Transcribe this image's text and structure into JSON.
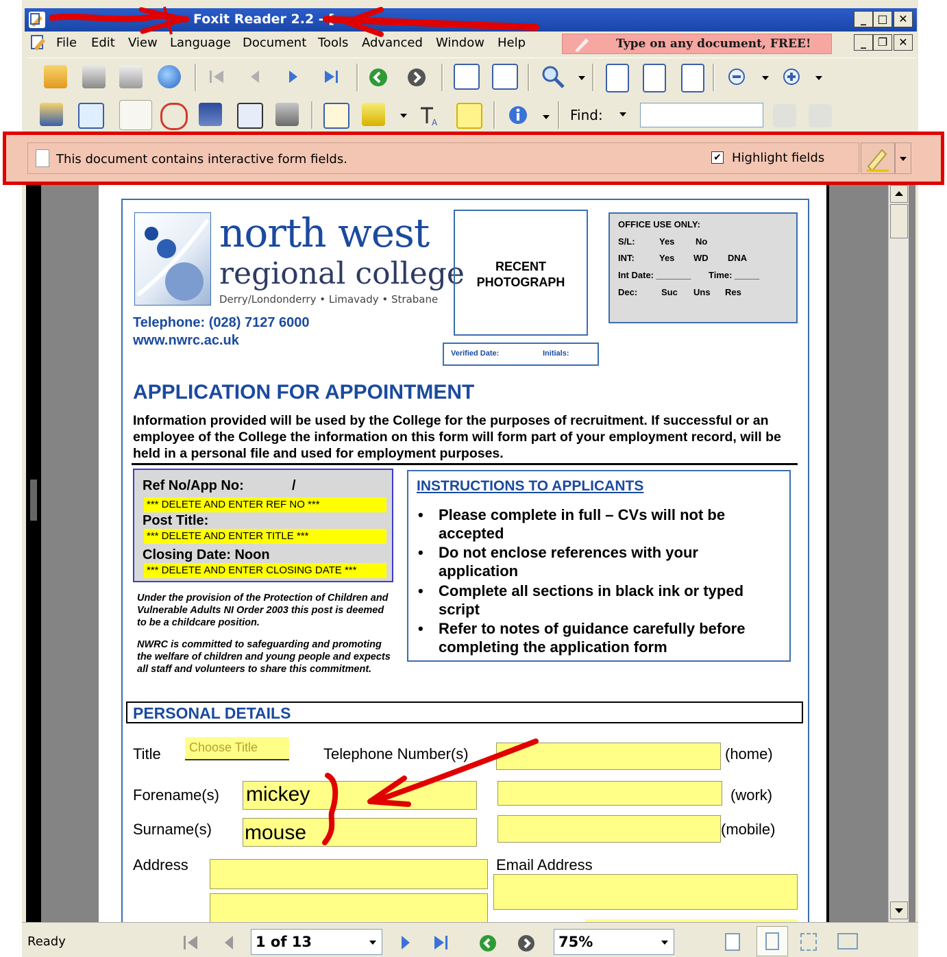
{
  "window": {
    "title": "Foxit Reader 2.2 - [",
    "controls": [
      "_",
      "□",
      "✕"
    ],
    "doc_controls": [
      "_",
      "❐",
      "✕"
    ]
  },
  "menu": [
    "File",
    "Edit",
    "View",
    "Language",
    "Document",
    "Tools",
    "Advanced",
    "Window",
    "Help"
  ],
  "promo": "Type on any document, FREE!",
  "toolbar": {
    "find_label": "Find:"
  },
  "formbar": {
    "message": "This document contains interactive form fields.",
    "highlight_label": "Highlight fields",
    "highlight_checked": "✔"
  },
  "document": {
    "logo": {
      "line1": "north west",
      "line2": "regional college",
      "line3": "Derry/Londonderry • Limavady • Strabane"
    },
    "telephone": "Telephone: (028) 7127 6000",
    "website": "www.nwrc.ac.uk",
    "photo_label": "RECENT PHOTOGRAPH",
    "verified_date": "Verified Date:",
    "initials": "Initials:",
    "office_use": {
      "title": "OFFICE USE ONLY:",
      "rows": [
        [
          "S/L:",
          "Yes",
          "No",
          ""
        ],
        [
          "INT:",
          "Yes",
          "WD",
          "DNA"
        ],
        [
          "Int Date: _______",
          "Time: _____",
          "",
          ""
        ],
        [
          "Dec:",
          "Suc",
          "Uns",
          "Res"
        ]
      ]
    },
    "heading": "APPLICATION FOR APPOINTMENT",
    "intro": "Information provided will be used by the College for the purposes of recruitment. If successful or an employee of the College the information on this form will form part of your employment record, will be held in a personal file and used for employment purposes.",
    "ref": {
      "ref_label": "Ref No/App No:",
      "slash": "/",
      "ref_value": "*** DELETE AND ENTER REF NO ***",
      "post_label": "Post Title:",
      "post_value": "*** DELETE AND ENTER TITLE ***",
      "closing_label": "Closing Date: Noon",
      "closing_value": "*** DELETE AND ENTER CLOSING DATE ***"
    },
    "childcare_note": "Under the provision of the Protection of Children and Vulnerable Adults NI Order 2003 this post is deemed to be a childcare position.",
    "safeguard_note": "NWRC is committed to safeguarding and promoting the welfare of children and young people and expects all staff and volunteers to share this commitment.",
    "instructions": {
      "title": "INSTRUCTIONS TO APPLICANTS",
      "items": [
        "Please complete in full – CVs will not be accepted",
        "Do not enclose references with your application",
        "Complete all sections in black ink or typed script",
        "Refer to notes of guidance carefully before completing the application form"
      ]
    },
    "personal": {
      "section_title": "PERSONAL DETAILS",
      "title_label": "Title",
      "title_placeholder": "Choose Title",
      "phone_label": "Telephone Number(s)",
      "home": "(home)",
      "work": "(work)",
      "mobile": "(mobile)",
      "forename_label": "Forename(s)",
      "forename_value": "mickey",
      "surname_label": "Surname(s)",
      "surname_value": "mouse",
      "address_label": "Address",
      "email_label": "Email Address"
    }
  },
  "status": {
    "ready": "Ready",
    "page": "1 of 13",
    "zoom": "75%"
  }
}
